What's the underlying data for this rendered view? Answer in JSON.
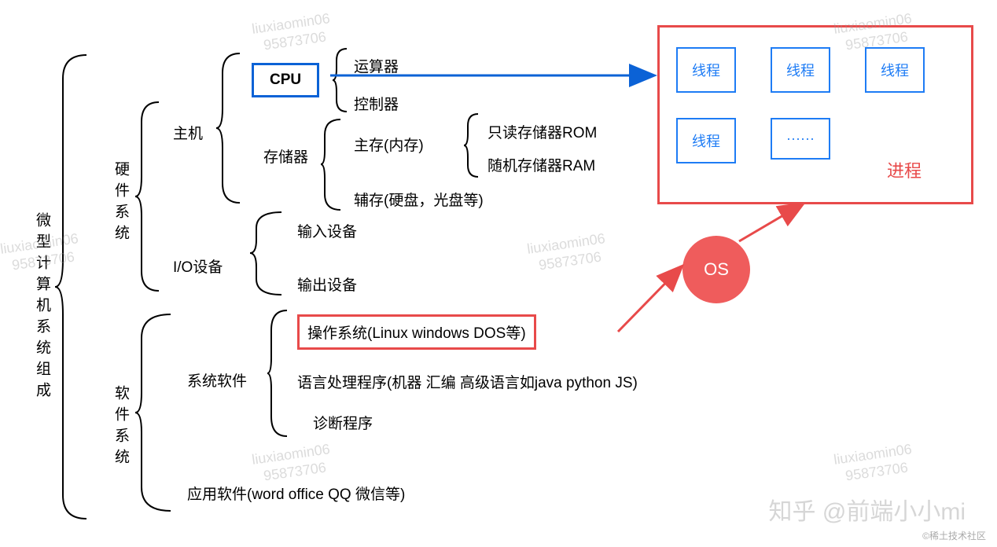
{
  "root": "微型计算机系统组成",
  "hardware": "硬件系统",
  "software": "软件系统",
  "host": "主机",
  "io": "I/O设备",
  "cpu": "CPU",
  "cpu_parts": {
    "alu": "运算器",
    "cu": "控制器"
  },
  "storage": "存储器",
  "main_mem": "主存(内存)",
  "rom": "只读存储器ROM",
  "ram": "随机存储器RAM",
  "aux_mem": "辅存(硬盘，光盘等)",
  "input_dev": "输入设备",
  "output_dev": "输出设备",
  "sys_software": "系统软件",
  "app_software": "应用软件(word office QQ 微信等)",
  "os_label": "操作系统(Linux windows DOS等)",
  "lang_proc": "语言处理程序(机器 汇编 高级语言如java python JS)",
  "diag": "诊断程序",
  "thread": "线程",
  "ellipsis": "······",
  "process": "进程",
  "os": "OS",
  "wm_user": "liuxiaomin06",
  "wm_id": "95873706",
  "zhihu": "知乎 @前端小小mi",
  "footer": "©稀土技术社区"
}
